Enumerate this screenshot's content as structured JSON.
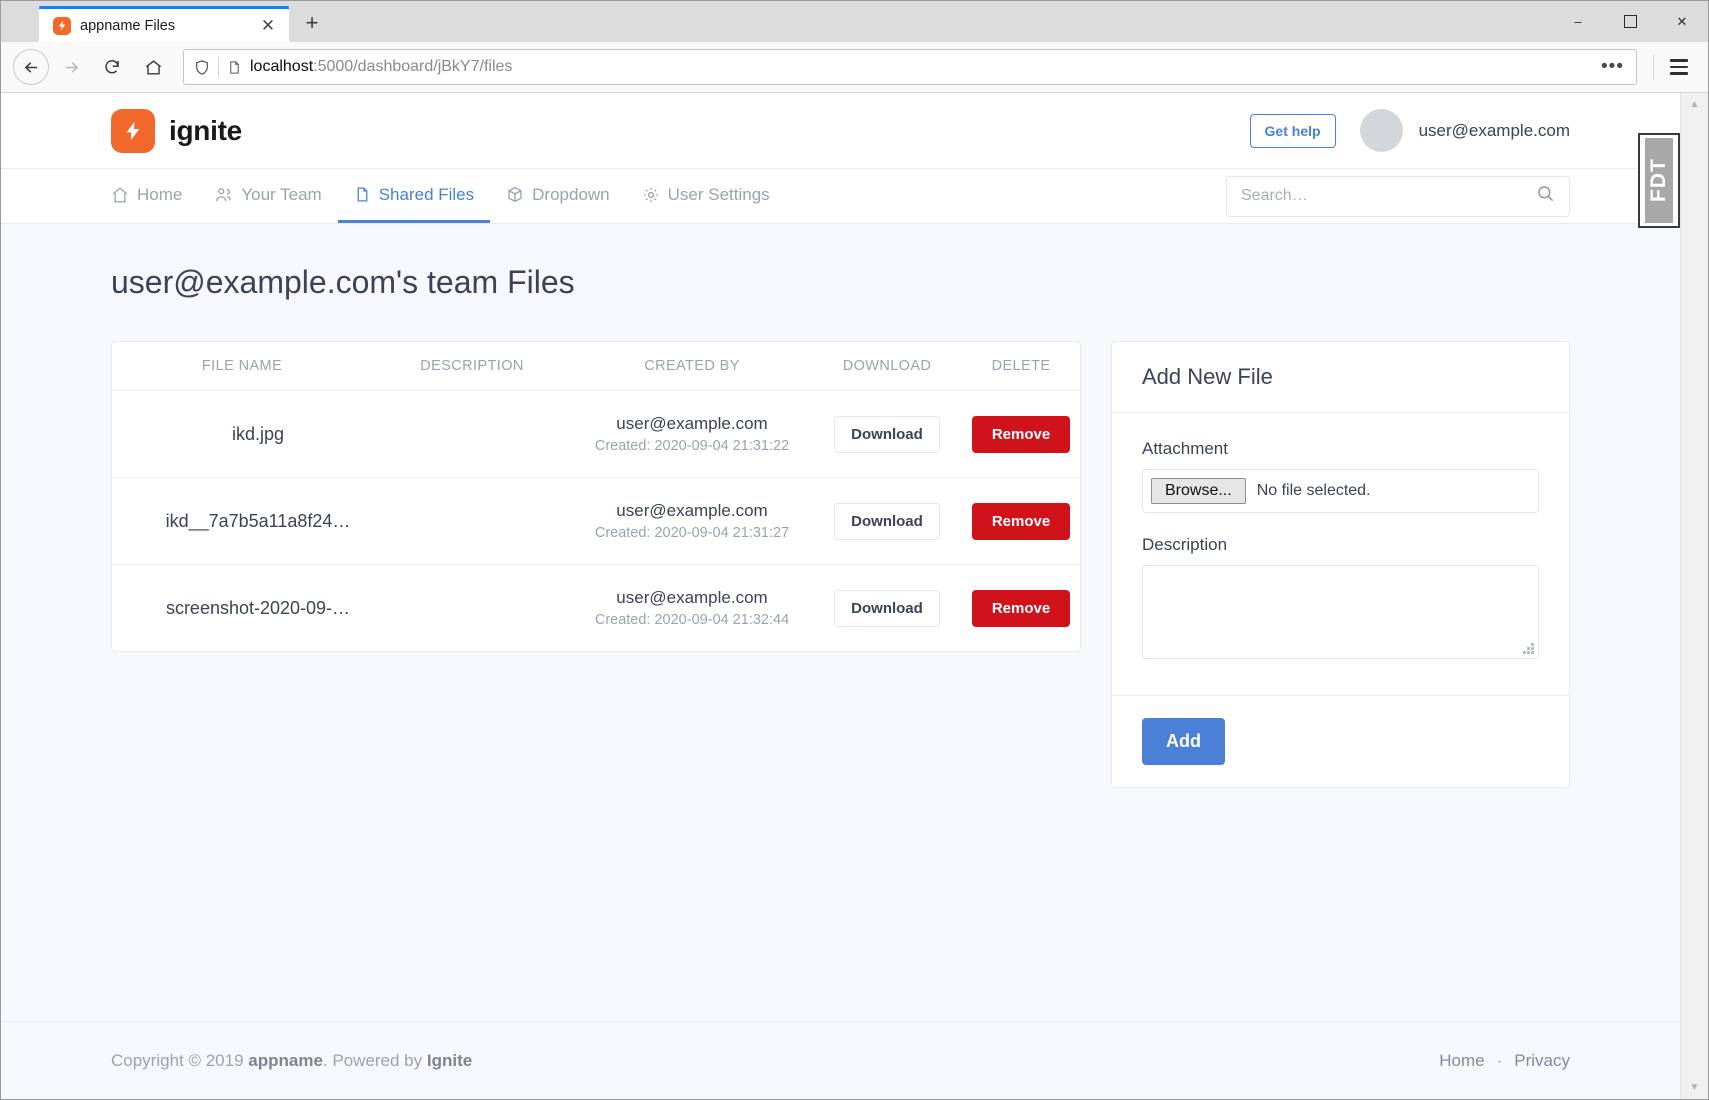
{
  "browser": {
    "tab_title": "appname Files",
    "tab_favicon_icon": "bolt-icon",
    "tab_close_icon": "✕",
    "newtab_label": "+",
    "window_minimize": "–",
    "window_maximize": "▢",
    "window_close": "✕",
    "url_value": "localhost:5000/dashboard/jBkY7/files",
    "url_host": "localhost",
    "url_path": ":5000/dashboard/jBkY7/files",
    "overflow_menu": "•••",
    "back_icon": "←",
    "forward_icon": "→",
    "reload_icon": "⟳",
    "home_icon": "⌂"
  },
  "side_tab": {
    "label": "FDT"
  },
  "header": {
    "brand_name": "ignite",
    "get_help_label": "Get help",
    "user_email": "user@example.com"
  },
  "nav": {
    "items": [
      {
        "label": "Home",
        "icon": "home-icon",
        "active": false
      },
      {
        "label": "Your Team",
        "icon": "users-icon",
        "active": false
      },
      {
        "label": "Shared Files",
        "icon": "file-icon",
        "active": true
      },
      {
        "label": "Dropdown",
        "icon": "box-icon",
        "active": false
      },
      {
        "label": "User Settings",
        "icon": "gear-icon",
        "active": false
      }
    ],
    "search_placeholder": "Search…",
    "search_value": "",
    "search_icon": "search-icon"
  },
  "main": {
    "page_title": "user@example.com's team Files",
    "table": {
      "columns": [
        "FILE NAME",
        "DESCRIPTION",
        "CREATED BY",
        "DOWNLOAD",
        "DELETE"
      ],
      "rows": [
        {
          "file_name": "ikd.jpg",
          "description": "",
          "created_by": "user@example.com",
          "created_at": "Created: 2020-09-04 21:31:22",
          "download_label": "Download",
          "delete_label": "Remove"
        },
        {
          "file_name": "ikd__7a7b5a11a8f24…",
          "description": "",
          "created_by": "user@example.com",
          "created_at": "Created: 2020-09-04 21:31:27",
          "download_label": "Download",
          "delete_label": "Remove"
        },
        {
          "file_name": "screenshot-2020-09-…",
          "description": "",
          "created_by": "user@example.com",
          "created_at": "Created: 2020-09-04 21:32:44",
          "download_label": "Download",
          "delete_label": "Remove"
        }
      ]
    },
    "add_panel": {
      "title": "Add New File",
      "attachment_label": "Attachment",
      "browse_label": "Browse...",
      "file_status": "No file selected.",
      "description_label": "Description",
      "description_value": "",
      "add_label": "Add"
    }
  },
  "footer": {
    "copyright_prefix": "Copyright © 2019 ",
    "app_name": "appname",
    "powered_by": ". Powered by ",
    "engine_name": "Ignite",
    "links": [
      {
        "label": "Home"
      },
      {
        "label": "·"
      },
      {
        "label": "Privacy"
      }
    ]
  },
  "colors": {
    "brand_orange": "#f2682a",
    "accent_blue": "#4a80d6",
    "danger_red": "#d0131b",
    "page_bg": "#f7f8fb"
  }
}
